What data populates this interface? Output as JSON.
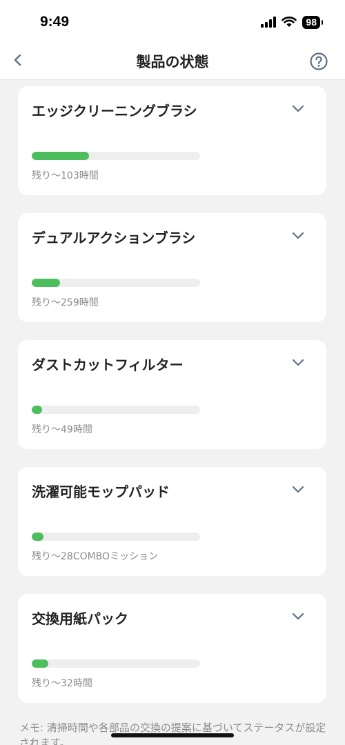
{
  "status": {
    "time": "9:49",
    "battery": "98"
  },
  "header": {
    "title": "製品の状態"
  },
  "parts": [
    {
      "name": "エッジクリーニングブラシ",
      "remaining": "残り〜103時間",
      "level": 0.34
    },
    {
      "name": "デュアルアクションブラシ",
      "remaining": "残り〜259時間",
      "level": 0.17
    },
    {
      "name": "ダストカットフィルター",
      "remaining": "残り〜49時間",
      "level": 0.06
    },
    {
      "name": "洗濯可能モップパッド",
      "remaining": "残り〜28COMBOミッション",
      "level": 0.07
    },
    {
      "name": "交換用紙パック",
      "remaining": "残り〜32時間",
      "level": 0.1
    }
  ],
  "note": "メモ: 清掃時間や各部品の交換の提案に基づいてステータスが設定されます。",
  "colors": {
    "progress": "#4dbe5e",
    "track": "#eeeeee",
    "icon": "#5a6f86"
  }
}
